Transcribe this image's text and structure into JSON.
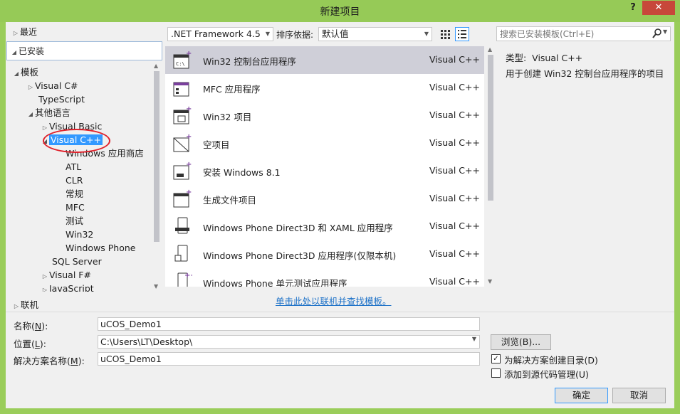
{
  "window": {
    "title": "新建项目",
    "help": "?",
    "close": "✕"
  },
  "nav": {
    "recent": "最近",
    "installed": "已安装",
    "online": "联机",
    "tree": [
      {
        "label": "模板"
      },
      {
        "label": "Visual C#"
      },
      {
        "label": "TypeScript"
      },
      {
        "label": "其他语言"
      },
      {
        "label": "Visual Basic"
      },
      {
        "label": "Visual C++"
      },
      {
        "label": "Windows 应用商店"
      },
      {
        "label": "ATL"
      },
      {
        "label": "CLR"
      },
      {
        "label": "常规"
      },
      {
        "label": "MFC"
      },
      {
        "label": "测试"
      },
      {
        "label": "Win32"
      },
      {
        "label": "Windows Phone"
      },
      {
        "label": "SQL Server"
      },
      {
        "label": "Visual F#"
      },
      {
        "label": "JavaScript"
      }
    ]
  },
  "toolbar": {
    "framework": ".NET Framework 4.5",
    "sort_label": "排序依据:",
    "sort_value": "默认值",
    "search_placeholder": "搜索已安装模板(Ctrl+E)"
  },
  "templates": [
    {
      "name": "Win32 控制台应用程序",
      "lang": "Visual C++",
      "icon": "console-app-icon"
    },
    {
      "name": "MFC 应用程序",
      "lang": "Visual C++",
      "icon": "mfc-app-icon"
    },
    {
      "name": "Win32 项目",
      "lang": "Visual C++",
      "icon": "win32-project-icon"
    },
    {
      "name": "空项目",
      "lang": "Visual C++",
      "icon": "empty-project-icon"
    },
    {
      "name": "安装 Windows 8.1",
      "lang": "Visual C++",
      "icon": "windows-install-icon"
    },
    {
      "name": "生成文件项目",
      "lang": "Visual C++",
      "icon": "makefile-project-icon"
    },
    {
      "name": "Windows Phone Direct3D 和 XAML 应用程序",
      "lang": "Visual C++",
      "icon": "phone-d3d-xaml-icon"
    },
    {
      "name": "Windows Phone Direct3D 应用程序(仅限本机)",
      "lang": "Visual C++",
      "icon": "phone-d3d-icon"
    },
    {
      "name": "Windows Phone 单元测试应用程序",
      "lang": "Visual C++",
      "icon": "phone-unit-test-icon"
    }
  ],
  "info": {
    "type_label": "类型:",
    "type_value": "Visual C++",
    "description": "用于创建 Win32 控制台应用程序的项目"
  },
  "online_link": "单击此处以联机并查找模板。",
  "form": {
    "name_label": "名称",
    "name_key": "N",
    "name_value": "uCOS_Demo1",
    "location_label": "位置",
    "location_key": "L",
    "location_value": "C:\\Users\\LT\\Desktop\\",
    "solution_label": "解决方案名称",
    "solution_key": "M",
    "solution_value": "uCOS_Demo1",
    "browse": "浏览(B)...",
    "create_dir": "为解决方案创建目录(D)",
    "add_source_control": "添加到源代码管理(U)",
    "ok": "确定",
    "cancel": "取消"
  },
  "colors": {
    "title_bar": "#96ca57",
    "close": "#c7473a",
    "selection": "#3399ff",
    "link": "#1e72c8",
    "annotation": "#e0202a"
  }
}
